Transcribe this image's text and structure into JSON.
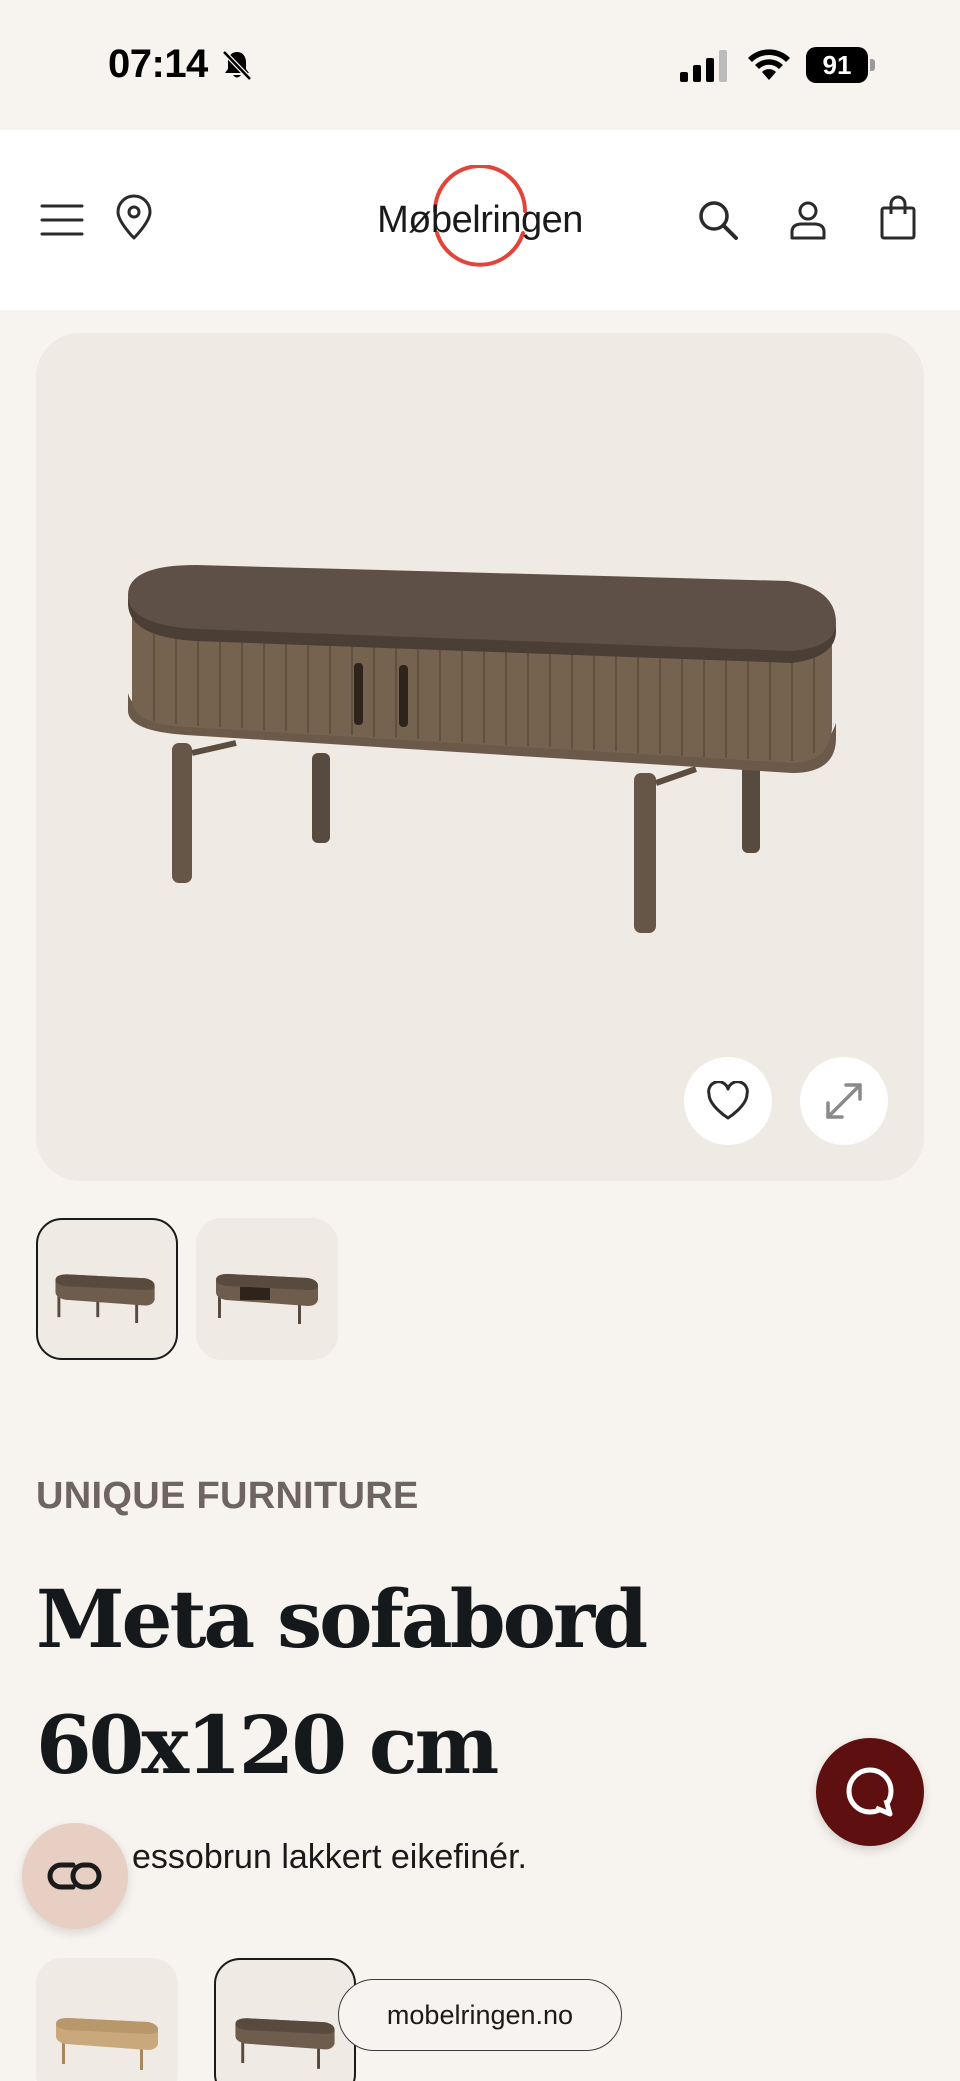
{
  "status_bar": {
    "time": "07:14",
    "battery": "91",
    "icons": [
      "bell-slash-icon",
      "signal-icon",
      "wifi-icon",
      "battery-icon"
    ]
  },
  "header": {
    "logo_text": "Møbelringen",
    "brand_color": "#e3443a",
    "icons": [
      "menu-icon",
      "location-pin-icon",
      "search-icon",
      "account-icon",
      "shopping-bag-icon"
    ]
  },
  "gallery": {
    "image_count": 2,
    "active_index": 0,
    "buttons": [
      "heart-icon",
      "expand-icon"
    ]
  },
  "product": {
    "brand": "UNIQUE FURNITURE",
    "title": "Meta sofabord 60x120 cm",
    "description_visible": "essobrun lakkert eikefinér."
  },
  "variants": {
    "count_visible": 2,
    "active_index": 1
  },
  "browser": {
    "url": "mobelringen.no"
  },
  "colors": {
    "page_bg": "#f7f3ef",
    "image_bg": "#efeae3",
    "chat_button": "#5e1010",
    "compare_button": "#e8cfc4"
  }
}
